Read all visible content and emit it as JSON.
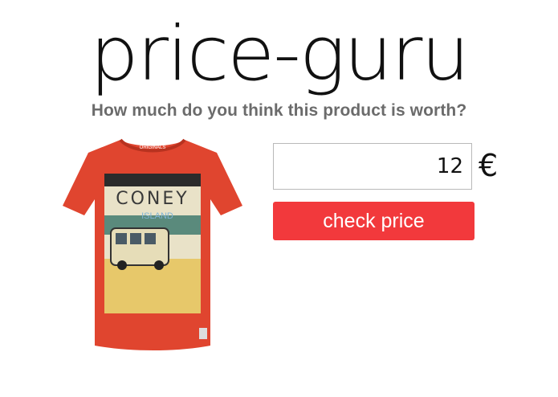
{
  "app": {
    "logo_text": "price-guru"
  },
  "question": {
    "text": "How much do you think this product is worth?"
  },
  "product": {
    "shirt_brand_tag": "ORIGINALS",
    "print_title": "CONEY",
    "print_subtitle": "ISLAND",
    "shirt_color": "#e0452f"
  },
  "guess": {
    "value": "12",
    "currency_symbol": "€"
  },
  "actions": {
    "check_label": "check price",
    "check_color": "#f2393c"
  }
}
